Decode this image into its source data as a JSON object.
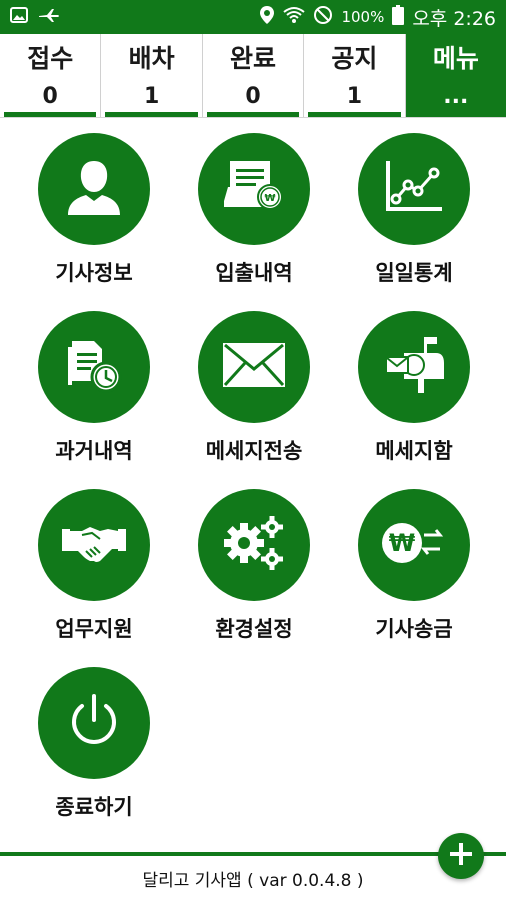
{
  "status_bar": {
    "battery_pct": "100%",
    "time": "오후 2:26",
    "icons": [
      "image-icon",
      "airplane-icon",
      "location-icon",
      "wifi-icon",
      "no-disturb-icon",
      "battery-icon"
    ]
  },
  "tabs": [
    {
      "label": "접수",
      "count": "0"
    },
    {
      "label": "배차",
      "count": "1"
    },
    {
      "label": "완료",
      "count": "0"
    },
    {
      "label": "공지",
      "count": "1"
    },
    {
      "label": "메뉴",
      "count": "..."
    }
  ],
  "menu": [
    {
      "label": "기사정보",
      "icon": "person-icon"
    },
    {
      "label": "입출내역",
      "icon": "receipt-won-icon"
    },
    {
      "label": "일일통계",
      "icon": "line-chart-icon"
    },
    {
      "label": "과거내역",
      "icon": "document-history-icon"
    },
    {
      "label": "메세지전송",
      "icon": "envelope-icon"
    },
    {
      "label": "메세지함",
      "icon": "mailbox-icon"
    },
    {
      "label": "업무지원",
      "icon": "handshake-icon"
    },
    {
      "label": "환경설정",
      "icon": "gears-icon"
    },
    {
      "label": "기사송금",
      "icon": "won-transfer-icon"
    },
    {
      "label": "종료하기",
      "icon": "power-icon"
    }
  ],
  "footer": {
    "text": "달리고 기사앱 ( var 0.0.4.8 )"
  },
  "colors": {
    "accent": "#11791a",
    "background": "#ffffff",
    "text": "#111111"
  }
}
